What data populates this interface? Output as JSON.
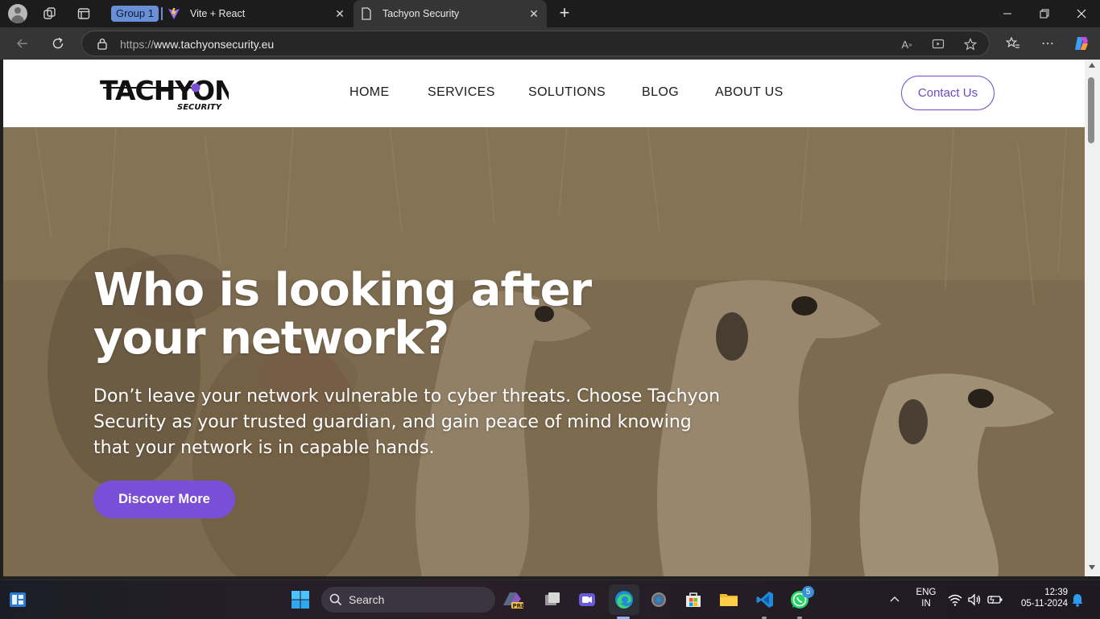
{
  "browser": {
    "tab_group_label": "Group 1",
    "tabs": [
      {
        "title": "Vite + React"
      },
      {
        "title": "Tachyon Security"
      }
    ],
    "address": {
      "scheme": "https://",
      "host": "www.tachyonsecurity.eu"
    }
  },
  "site": {
    "logo": {
      "wordmark": "TACHYON",
      "tagline": "SECURITY"
    },
    "nav": [
      "HOME",
      "SERVICES",
      "SOLUTIONS",
      "BLOG",
      "ABOUT US"
    ],
    "contact_label": "Contact Us",
    "hero": {
      "title": "Who is looking after your network?",
      "text": "Don’t leave your network vulnerable to cyber threats. Choose Tachyon Security as your trusted guardian, and gain peace of mind knowing that your network is in capable hands.",
      "button_label": "Discover More"
    },
    "accent_color": "#7a4fd8"
  },
  "taskbar": {
    "search_label": "Search",
    "language": "ENG",
    "region": "IN",
    "time": "12:39",
    "date": "05-11-2024",
    "whatsapp_badge": "5"
  }
}
